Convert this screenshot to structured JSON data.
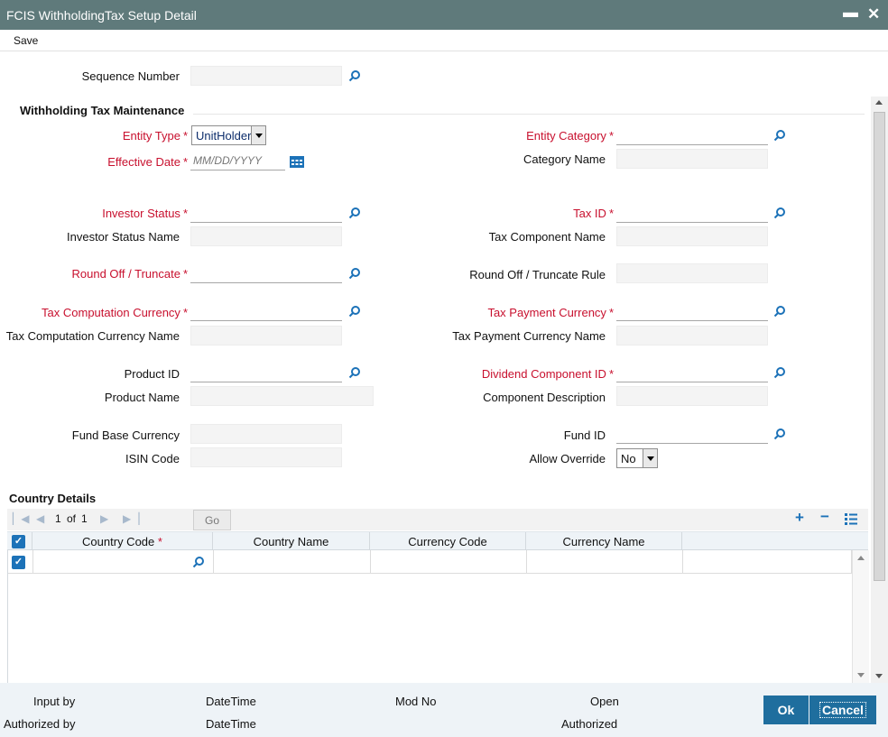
{
  "window": {
    "title": "FCIS WithholdingTax Setup Detail",
    "minimize_label": "▬",
    "close_label": "✕"
  },
  "menu": {
    "save_label": "Save"
  },
  "sequence_number": {
    "label": "Sequence Number",
    "value": ""
  },
  "section_title": "Withholding Tax Maintenance",
  "left": {
    "entity_type": {
      "label": "Entity Type",
      "value": "UnitHolder"
    },
    "effective_date": {
      "label": "Effective Date",
      "placeholder": "MM/DD/YYYY"
    },
    "investor_status": {
      "label": "Investor Status"
    },
    "investor_status_name": {
      "label": "Investor Status Name"
    },
    "round_off": {
      "label": "Round Off / Truncate"
    },
    "tax_comp_currency": {
      "label": "Tax Computation Currency"
    },
    "tax_comp_currency_name": {
      "label": "Tax Computation Currency Name"
    },
    "product_id": {
      "label": "Product ID"
    },
    "product_name": {
      "label": "Product Name"
    },
    "fund_base_currency": {
      "label": "Fund Base Currency"
    },
    "isin_code": {
      "label": "ISIN Code"
    }
  },
  "right": {
    "entity_category": {
      "label": "Entity Category"
    },
    "category_name": {
      "label": "Category Name"
    },
    "tax_id": {
      "label": "Tax ID"
    },
    "tax_component_name": {
      "label": "Tax Component Name"
    },
    "round_off_rule": {
      "label": "Round Off / Truncate Rule"
    },
    "tax_payment_currency": {
      "label": "Tax Payment Currency"
    },
    "tax_payment_currency_name": {
      "label": "Tax Payment Currency Name"
    },
    "dividend_component_id": {
      "label": "Dividend Component ID"
    },
    "component_description": {
      "label": "Component Description"
    },
    "fund_id": {
      "label": "Fund ID"
    },
    "allow_override": {
      "label": "Allow Override",
      "value": "No"
    }
  },
  "country_details": {
    "title": "Country Details",
    "pager": {
      "page": "1",
      "of_label": "of",
      "total": "1"
    },
    "go_label": "Go",
    "columns": [
      "Country Code",
      "Country Name",
      "Currency Code",
      "Currency Name"
    ],
    "required_star": "*"
  },
  "footer": {
    "input_by": "Input by",
    "authorized_by": "Authorized by",
    "datetime1": "DateTime",
    "datetime2": "DateTime",
    "mod_no": "Mod No",
    "open": "Open",
    "authorized": "Authorized",
    "ok_label": "Ok",
    "cancel_label": "Cancel"
  },
  "colors": {
    "titlebar": "#5f7a7b",
    "required": "#c8102e",
    "accent": "#1c72b8",
    "button": "#1f6e9e"
  }
}
